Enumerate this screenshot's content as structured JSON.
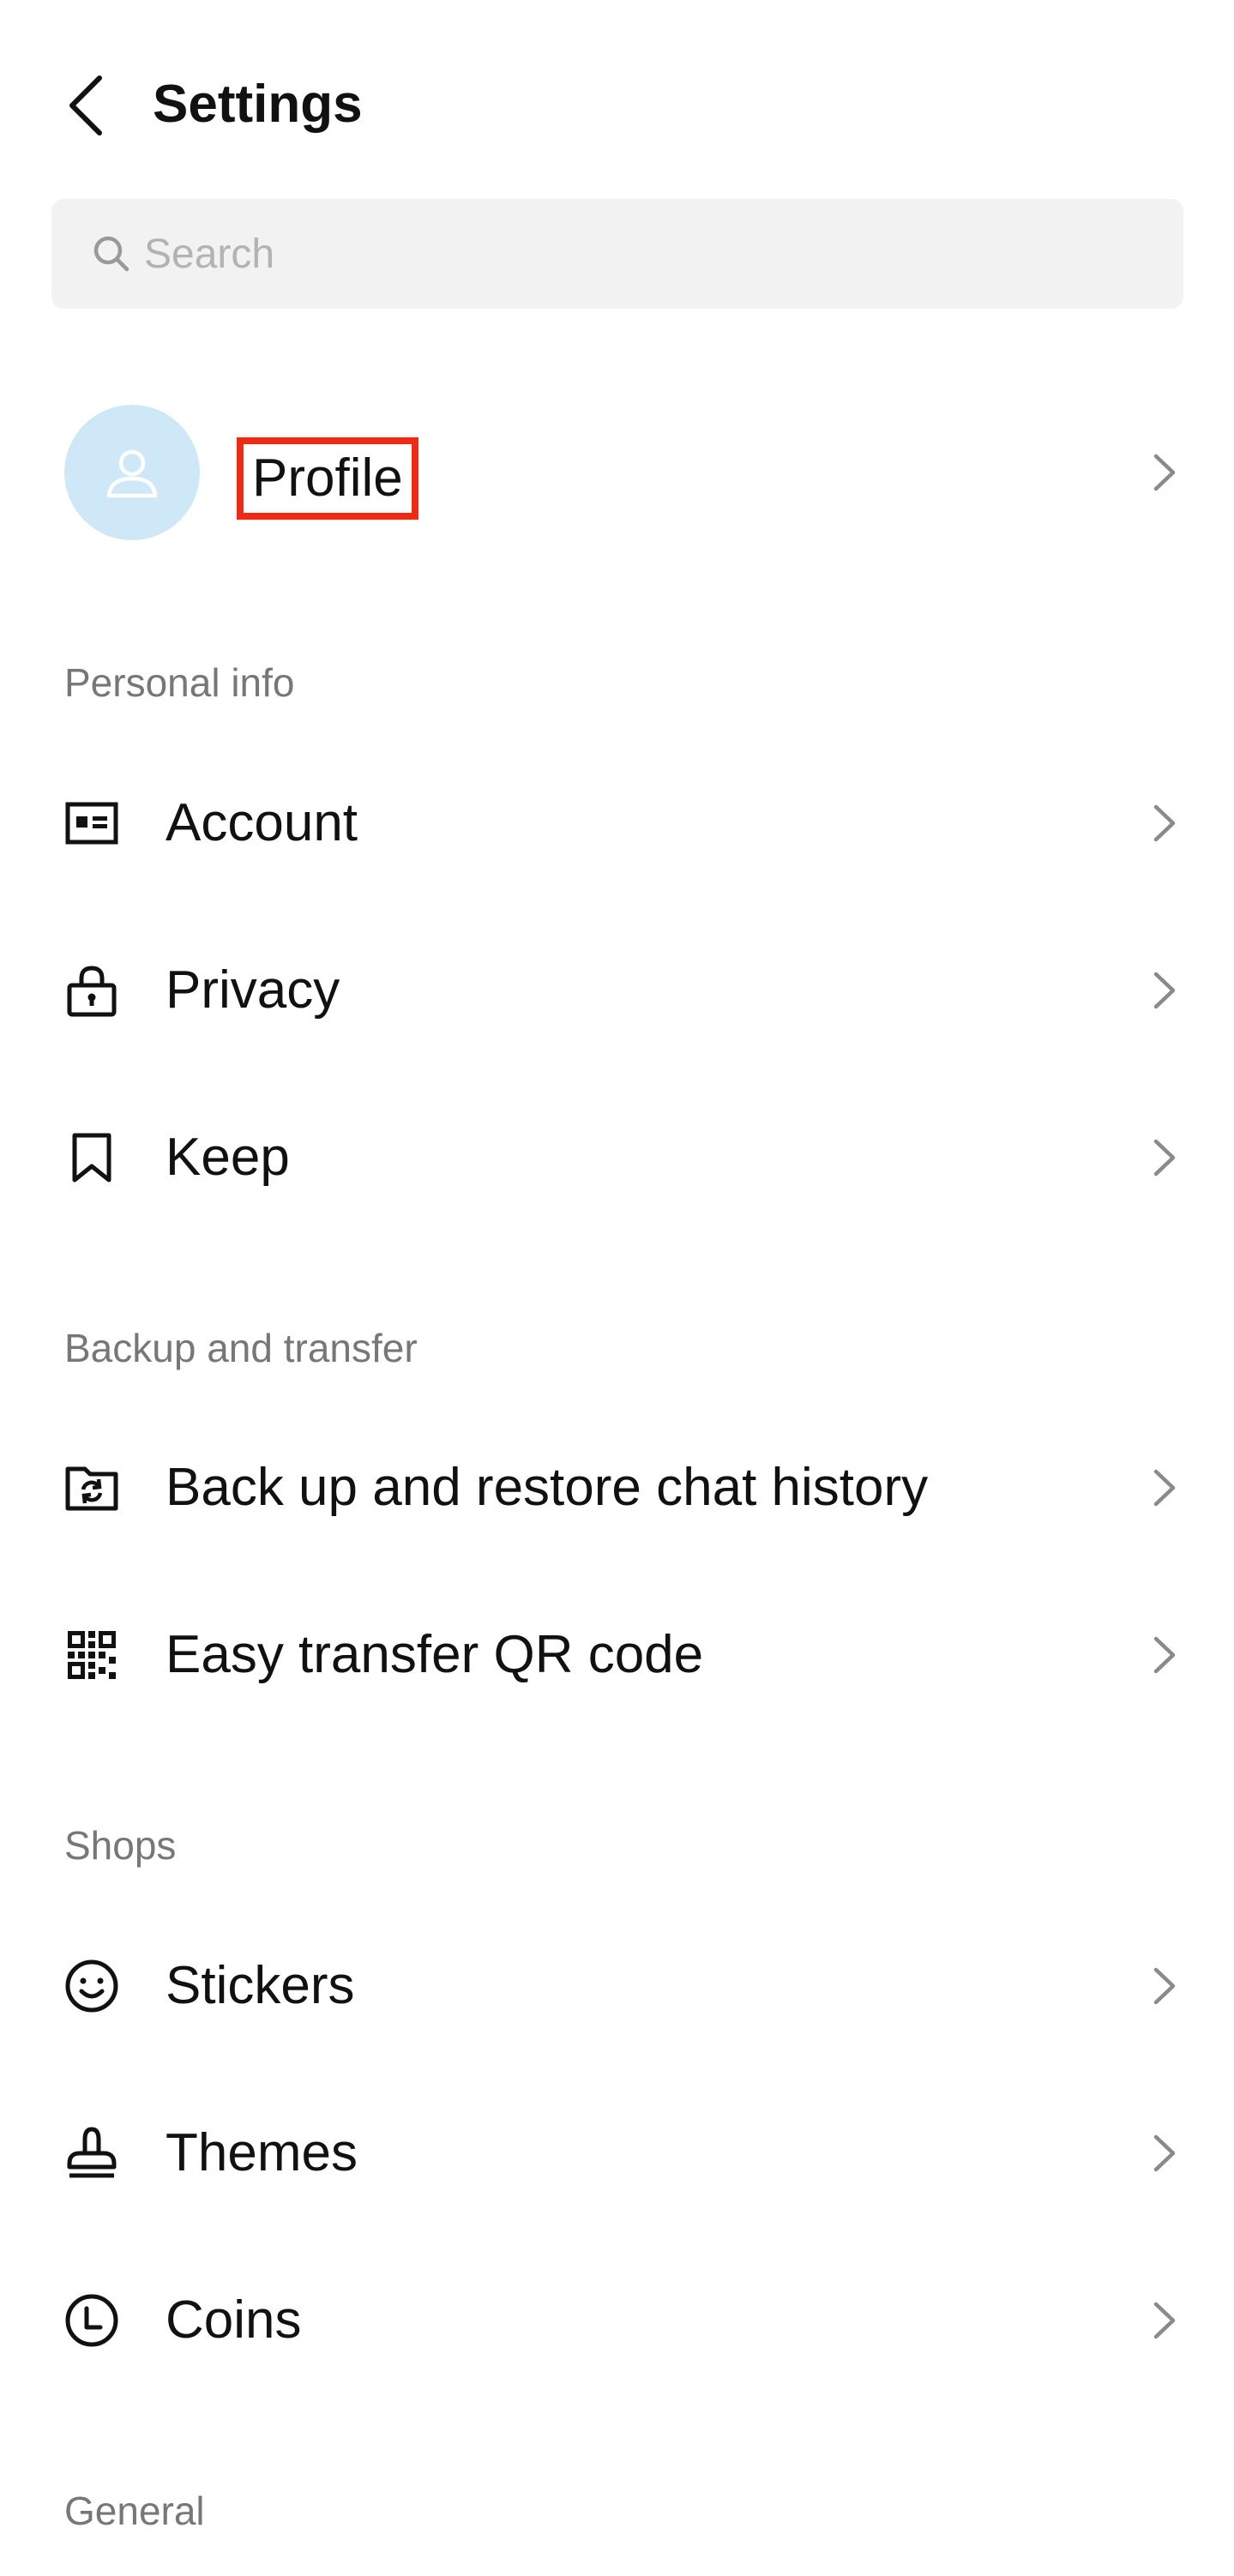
{
  "header": {
    "title": "Settings",
    "back_icon": "chevron-left-icon"
  },
  "search": {
    "placeholder": "Search",
    "value": "",
    "icon": "search-icon"
  },
  "profile": {
    "label": "Profile",
    "avatar_icon": "user-icon",
    "avatar_color": "#cfe8f7",
    "highlight_color": "#ef2a14"
  },
  "sections": [
    {
      "title": "Personal info",
      "items": [
        {
          "label": "Account",
          "icon": "id-card-icon"
        },
        {
          "label": "Privacy",
          "icon": "lock-icon"
        },
        {
          "label": "Keep",
          "icon": "bookmark-icon"
        }
      ]
    },
    {
      "title": "Backup and transfer",
      "items": [
        {
          "label": "Back up and restore chat history",
          "icon": "folder-sync-icon"
        },
        {
          "label": "Easy transfer QR code",
          "icon": "qr-code-icon"
        }
      ]
    },
    {
      "title": "Shops",
      "items": [
        {
          "label": "Stickers",
          "icon": "smiley-icon"
        },
        {
          "label": "Themes",
          "icon": "stamp-icon"
        },
        {
          "label": "Coins",
          "icon": "clock-coin-icon"
        }
      ]
    },
    {
      "title": "General",
      "items": []
    }
  ]
}
